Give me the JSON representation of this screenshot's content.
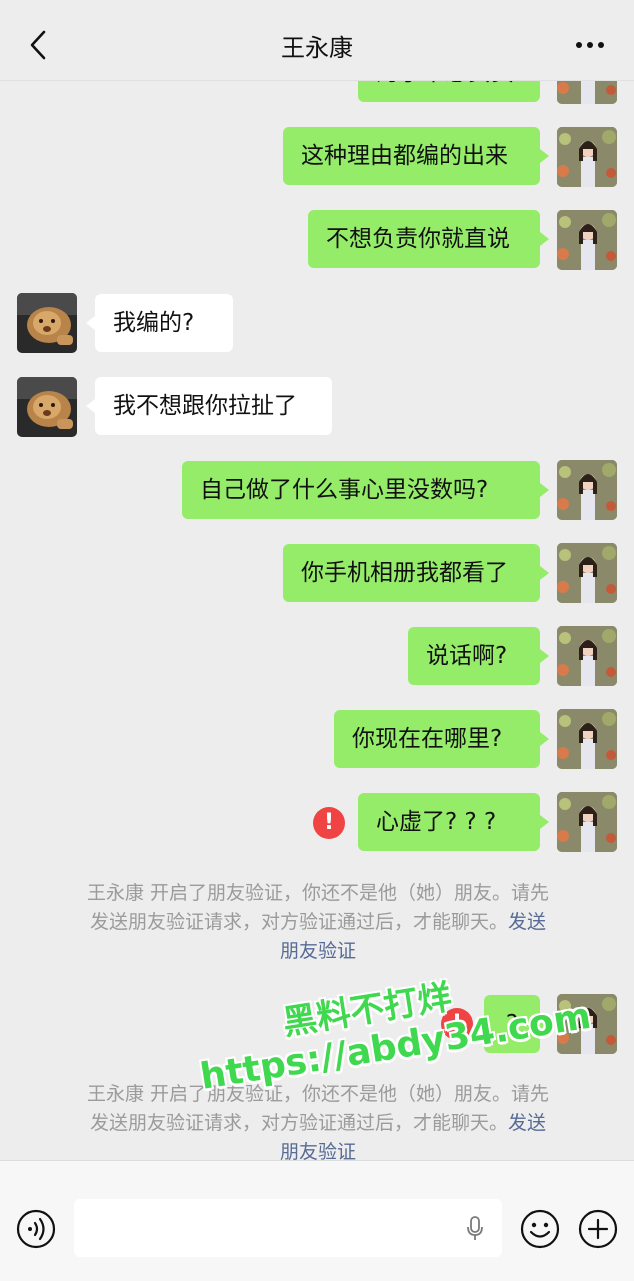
{
  "header": {
    "title": "王永康"
  },
  "messages": {
    "m0": "为了不想负责",
    "m1": "这种理由都编的出来",
    "m2": "不想负责你就直说",
    "m3": "我编的?",
    "m4": "我不想跟你拉扯了",
    "m5": "自己做了什么事心里没数吗?",
    "m6": "你手机相册我都看了",
    "m7": "说话啊?",
    "m8": "你现在在哪里?",
    "m9": "心虚了? ? ?",
    "m10": "?"
  },
  "system_notice": {
    "line1": "王永康 开启了朋友验证，你还不是他（她）朋友。请先",
    "line2": "发送朋友验证请求，对方验证通过后，才能聊天。",
    "link_part1": "发送",
    "link_part2": "朋友验证"
  },
  "error_mark": "!",
  "watermark": {
    "line1": "黑料不打烊",
    "line2": "https://abdy34.com"
  },
  "colors": {
    "my_bubble": "#95ec69",
    "their_bubble": "#ffffff",
    "error": "#f04343",
    "link": "#576b95",
    "background": "#ededed"
  },
  "icons": {
    "back": "chevron-left-icon",
    "more": "more-dots-icon",
    "voice": "voice-icon",
    "mic": "mic-icon",
    "emoji": "emoji-icon",
    "plus": "plus-icon"
  }
}
